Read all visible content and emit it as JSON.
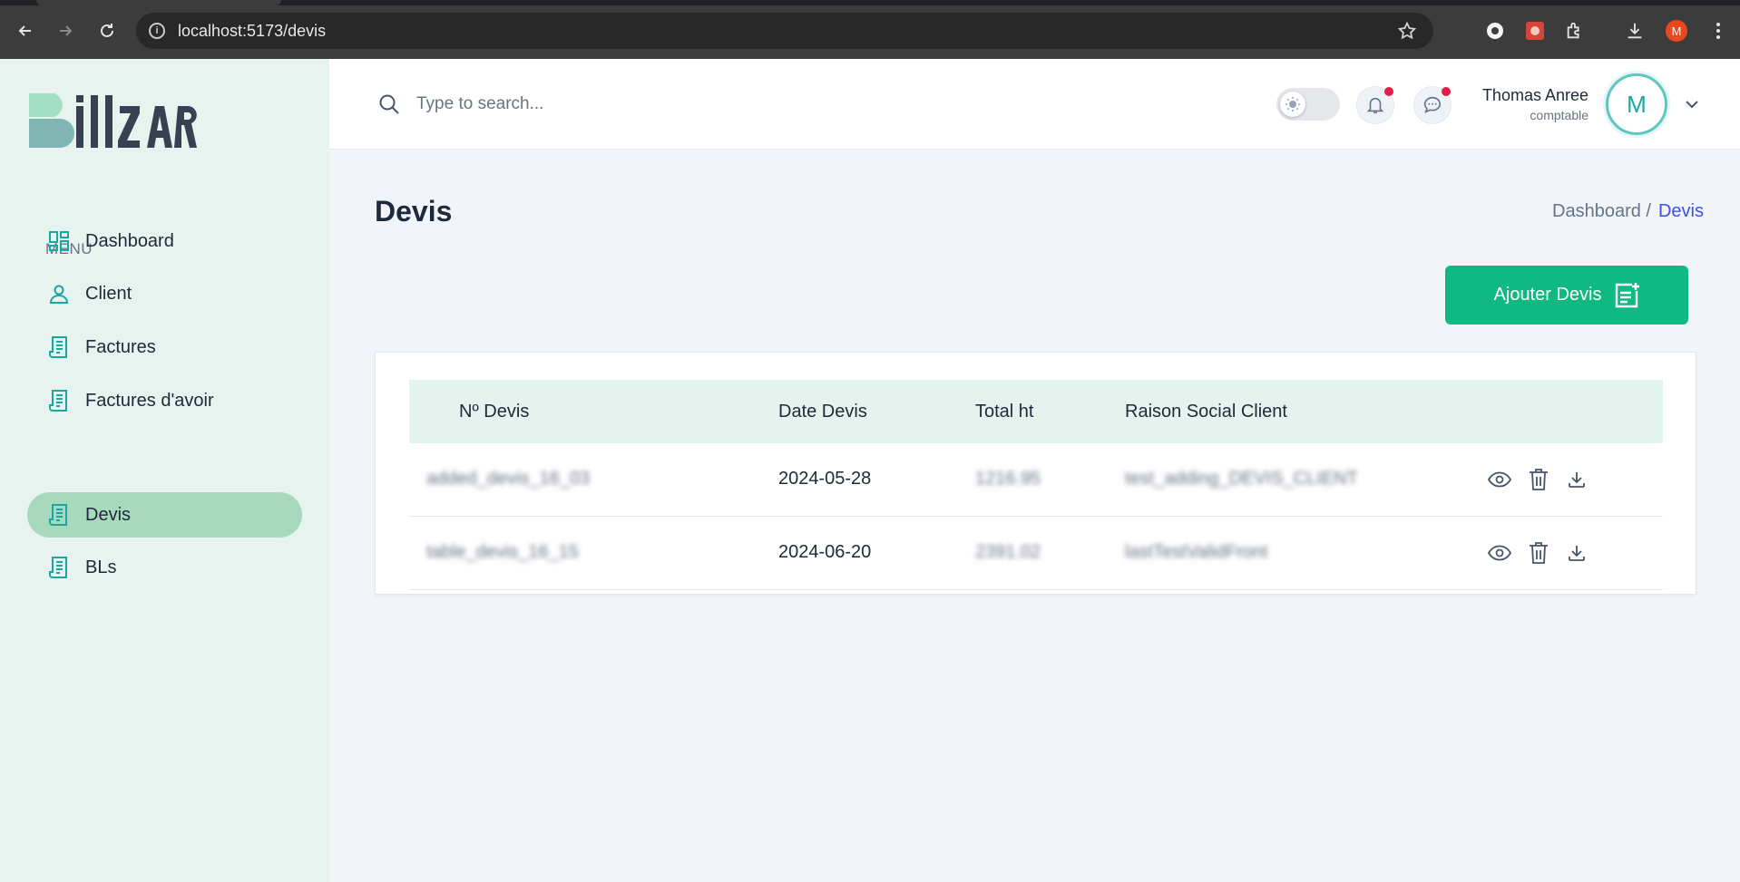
{
  "browser": {
    "url": "localhost:5173/devis",
    "profile_initial": "M"
  },
  "sidebar": {
    "logo_text": "Billzar",
    "menu_title": "MENU",
    "items": [
      {
        "label": "Dashboard",
        "icon": "dashboard-icon"
      },
      {
        "label": "Client",
        "icon": "user-icon"
      },
      {
        "label": "Factures",
        "icon": "receipt-icon"
      },
      {
        "label": "Factures d'avoir",
        "icon": "receipt-icon"
      },
      {
        "label": "Devis",
        "icon": "receipt-icon",
        "active": true
      },
      {
        "label": "BLs",
        "icon": "receipt-icon"
      }
    ]
  },
  "header": {
    "search_placeholder": "Type to search...",
    "user_name": "Thomas Anree",
    "user_role": "comptable",
    "avatar_initial": "M"
  },
  "page": {
    "title": "Devis",
    "breadcrumb_home": "Dashboard /",
    "breadcrumb_current": "Devis",
    "add_button_label": "Ajouter Devis"
  },
  "table": {
    "columns": [
      "Nº Devis",
      "Date Devis",
      "Total ht",
      "Raison Social Client"
    ],
    "rows": [
      {
        "num": "added_devis_16_03",
        "date": "2024-05-28",
        "total": "1216.95",
        "client": "test_adding_DEVIS_CLIENT"
      },
      {
        "num": "table_devis_16_15",
        "date": "2024-06-20",
        "total": "2391.02",
        "client": "lastTestValidFront"
      }
    ]
  },
  "colors": {
    "accent": "#10b981",
    "sidebar_bg": "#e6f3ef",
    "active_item": "#a8d9be",
    "teal_icon": "#1aa7a0",
    "link_blue": "#3c50e0",
    "notification_dot": "#e11d48"
  }
}
